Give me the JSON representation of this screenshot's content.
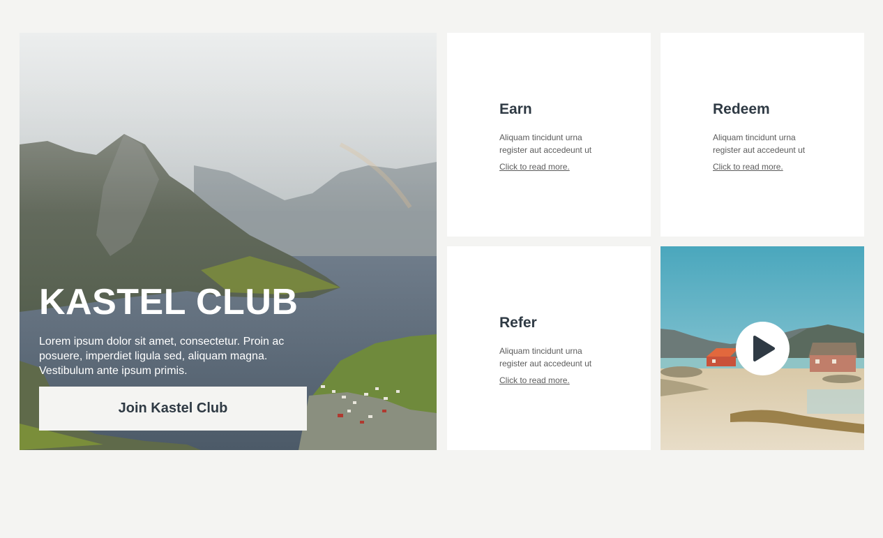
{
  "hero": {
    "title": "KASTEL CLUB",
    "text": "Lorem ipsum dolor sit amet, consectetur. Proin ac posuere, imperdiet ligula sed, aliquam magna. Vestibulum ante ipsum primis.",
    "button_label": "Join Kastel Club"
  },
  "cards": [
    {
      "title": "Earn",
      "text": "Aliquam tincidunt urna register aut accedeunt ut",
      "link": "Click to read more."
    },
    {
      "title": "Redeem",
      "text": "Aliquam tincidunt urna register aut accedeunt ut",
      "link": "Click to read more."
    },
    {
      "title": "Refer",
      "text": "Aliquam tincidunt urna register aut accedeunt ut",
      "link": "Click to read more."
    }
  ],
  "video": {
    "icon": "play-icon"
  },
  "colors": {
    "page_background": "#f4f4f2",
    "card_background": "#ffffff",
    "heading_text": "#2f3a44",
    "body_text": "#5b5b5b"
  }
}
